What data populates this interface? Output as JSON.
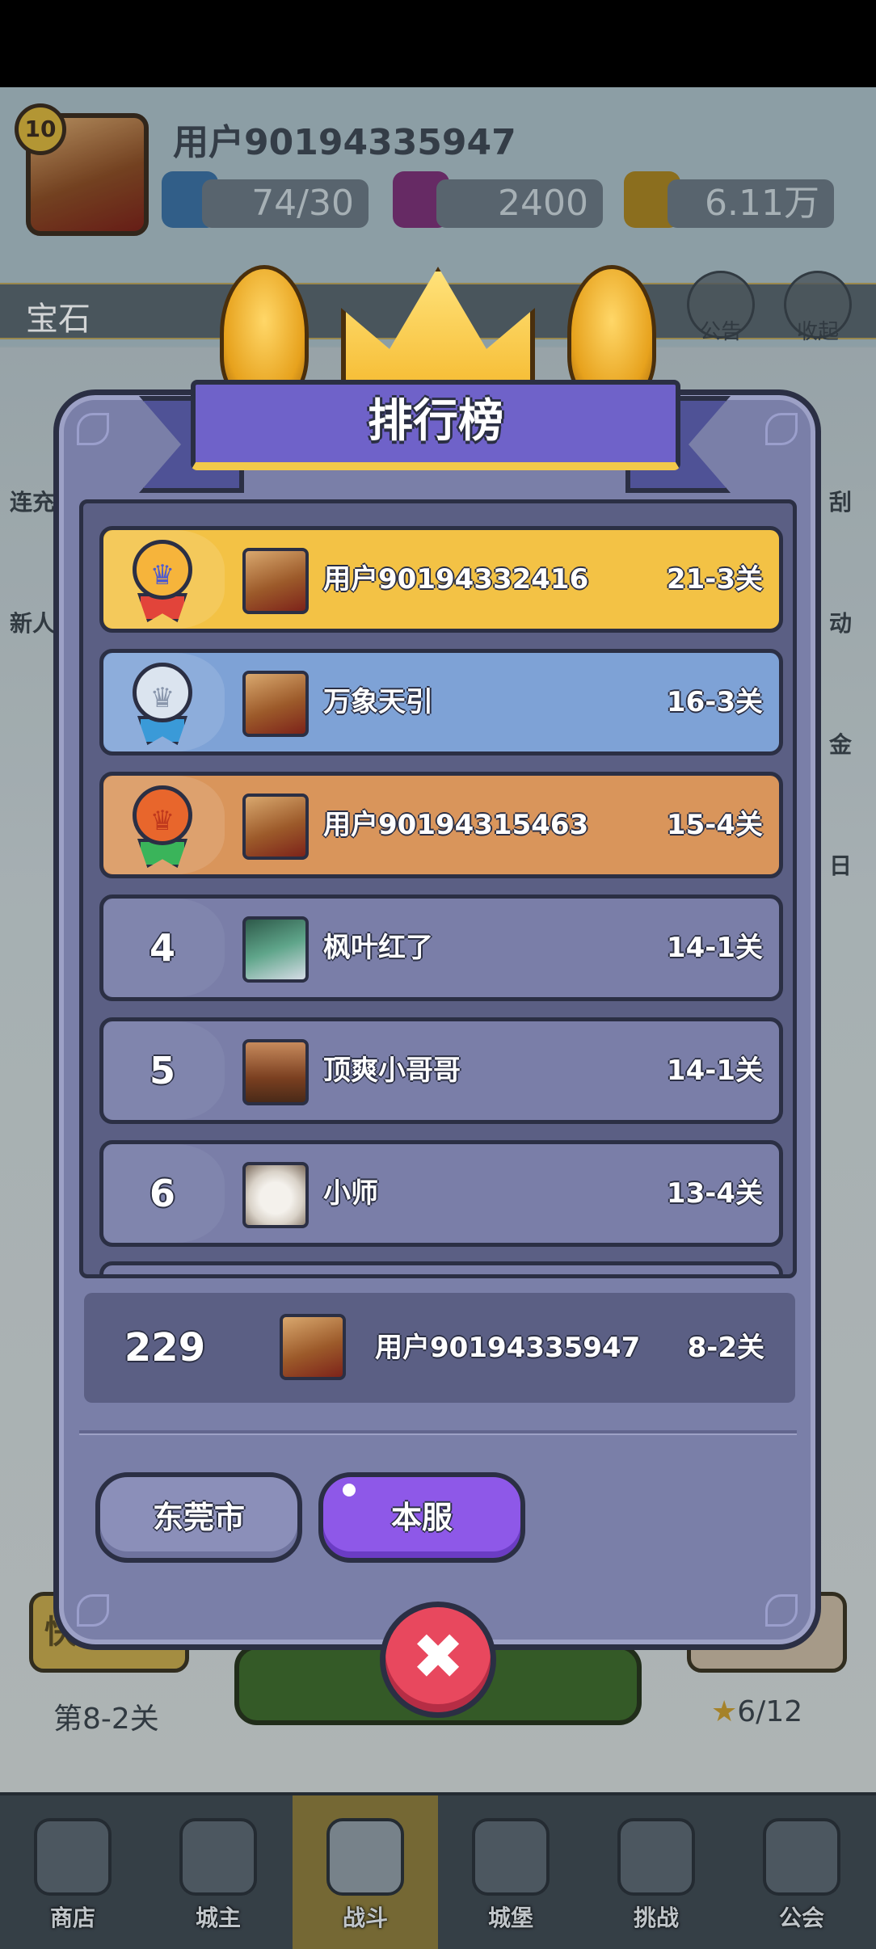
{
  "hud": {
    "level": "10",
    "username": "用户90194335947",
    "energy": "74/30",
    "gems": "2400",
    "coins": "6.11万",
    "marquee_text": "宝石",
    "right_buttons": [
      "公告",
      "收起"
    ]
  },
  "side_left": [
    "连充",
    "新人"
  ],
  "side_right": [
    "刮",
    "动",
    "金",
    "日"
  ],
  "background": {
    "quick_battle_label": "快速挂机",
    "stage_label": "第8-2关",
    "stars_label": "6/12"
  },
  "leaderboard": {
    "title": "排行榜",
    "rows": [
      {
        "rank": "1",
        "name": "用户90194332416",
        "score": "21-3关",
        "style": "gold",
        "avatar": "avatar-hero"
      },
      {
        "rank": "2",
        "name": "万象天引",
        "score": "16-3关",
        "style": "silver",
        "avatar": "avatar-hero"
      },
      {
        "rank": "3",
        "name": "用户90194315463",
        "score": "15-4关",
        "style": "bronze",
        "avatar": "avatar-hero"
      },
      {
        "rank": "4",
        "name": "枫叶红了",
        "score": "14-1关",
        "style": "plain",
        "avatar": "avatar-green"
      },
      {
        "rank": "5",
        "name": "顶爽小哥哥",
        "score": "14-1关",
        "style": "plain",
        "avatar": "avatar-tree"
      },
      {
        "rank": "6",
        "name": "小师",
        "score": "13-4关",
        "style": "plain",
        "avatar": "avatar-dog"
      }
    ],
    "self": {
      "rank": "229",
      "name": "用户90194335947",
      "score": "8-2关"
    },
    "tabs": {
      "local": "东莞市",
      "server": "本服"
    },
    "close_glyph": "✖"
  },
  "bottom_nav": [
    {
      "label": "商店"
    },
    {
      "label": "城主"
    },
    {
      "label": "战斗"
    },
    {
      "label": "城堡"
    },
    {
      "label": "挑战"
    },
    {
      "label": "公会"
    }
  ],
  "colors": {
    "panel": "#7a7fa8",
    "gold_row": "#f3c245",
    "silver_row": "#7ea2d6",
    "bronze_row": "#d9955b",
    "tab_active": "#8e58e8",
    "close_button": "#e8485e"
  }
}
